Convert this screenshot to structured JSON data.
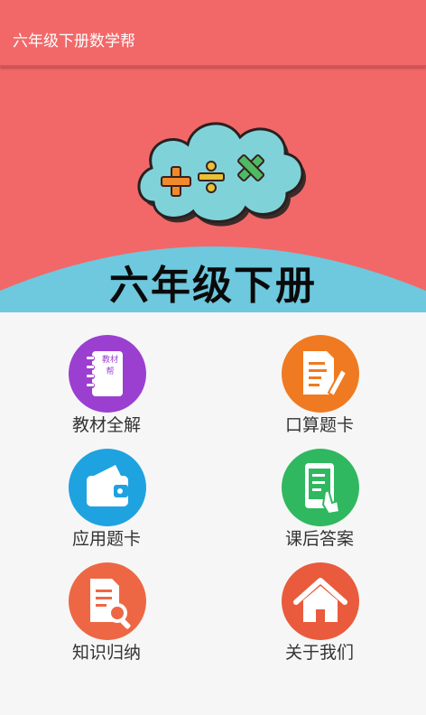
{
  "app_bar": {
    "title": "六年级下册数学帮",
    "color": "#f26868"
  },
  "banner": {
    "title": "六年级下册",
    "symbols": [
      "+",
      "÷",
      "×"
    ],
    "background": "#f26868",
    "hill_color": "#6ec8de",
    "cloud_color": "#7fd3d8"
  },
  "menu": {
    "items": [
      {
        "label": "教材全解",
        "icon": "textbook-icon",
        "color": "#9b3fd0",
        "book_text": "教材帮"
      },
      {
        "label": "口算题卡",
        "icon": "document-pen-icon",
        "color": "#ef7a21"
      },
      {
        "label": "应用题卡",
        "icon": "wallet-icon",
        "color": "#1fa2e0"
      },
      {
        "label": "课后答案",
        "icon": "tablet-touch-icon",
        "color": "#2fb85f"
      },
      {
        "label": "知识归纳",
        "icon": "document-search-icon",
        "color": "#ee6744"
      },
      {
        "label": "关于我们",
        "icon": "home-icon",
        "color": "#e95b3c"
      }
    ]
  }
}
